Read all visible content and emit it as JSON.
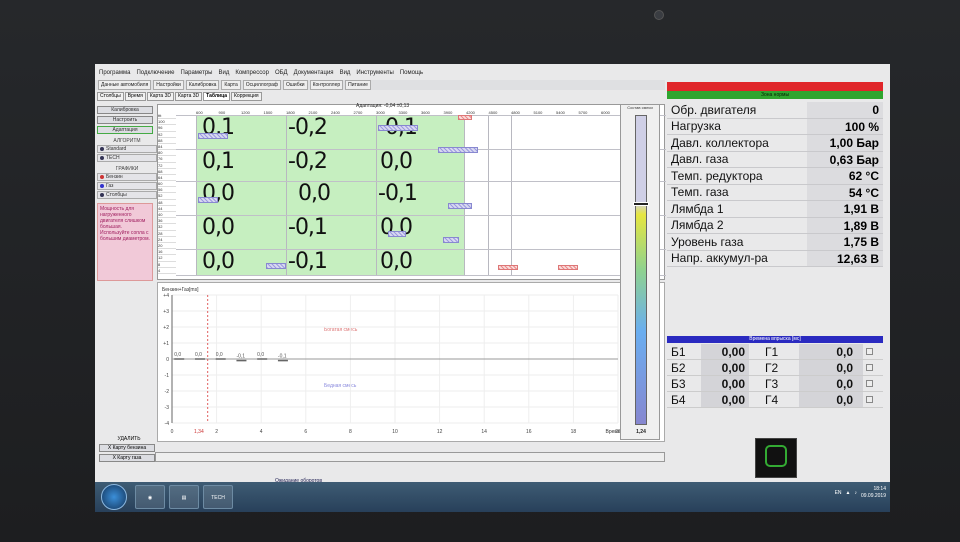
{
  "menu": [
    "Программа",
    "Подключение",
    "Параметры",
    "Вид",
    "Компрессор",
    "ОБД",
    "Документация",
    "Вид",
    "Инструменты",
    "Помощь"
  ],
  "toolbar": [
    "Данные автомобиля",
    "Настройки",
    "Калибровка",
    "Карта",
    "Осциллограф",
    "Ошибки",
    "Контроллер",
    "Питание"
  ],
  "tabs": [
    "Столбцы",
    "Время",
    "Карта 3D",
    "Карта 3D",
    "Таблица",
    "Коррекция"
  ],
  "active_tab_index": 4,
  "left": {
    "calibration": "Калибровка",
    "setup": "Настроить",
    "adaptation": "Адаптация",
    "algorithm_head": "АЛГОРИТМ",
    "algo_options": [
      "Standard",
      "TECH"
    ],
    "graphs_head": "ГРАФИКИ",
    "graph_options": [
      "Бензин",
      "Газ",
      "Столбцы"
    ],
    "note": "Мощность для нагруженного двигателя слишком большая. Используйте сопла с большим диаметром."
  },
  "grid": {
    "adapt_label": "Адаптация: -0,04   ±0,13",
    "col_headers": [
      "600",
      "900",
      "1200",
      "1500",
      "1800",
      "2100",
      "2400",
      "2700",
      "3000",
      "3300",
      "3600",
      "3900",
      "4200",
      "4500",
      "4800",
      "5100",
      "5400",
      "5700",
      "6000",
      "6300"
    ],
    "row_headers": [
      "ttt",
      "100",
      "96",
      "92",
      "88",
      "84",
      "80",
      "76",
      "72",
      "68",
      "64",
      "60",
      "56",
      "52",
      "48",
      "44",
      "40",
      "36",
      "32",
      "28",
      "24",
      "20",
      "16",
      "12",
      "8",
      "4"
    ],
    "cells": [
      [
        "0,1",
        "-0,2",
        "-0,1"
      ],
      [
        "0,1",
        "-0,2",
        "0,0"
      ],
      [
        "0,0",
        "0,0",
        "-0,1"
      ],
      [
        "0,0",
        "-0,1",
        "0,0"
      ],
      [
        "0,0",
        "-0,1",
        "0,0"
      ]
    ]
  },
  "chart_data": {
    "type": "line",
    "title": "Бензин+Газ[ms]",
    "xlabel": "Время[ms]",
    "ylabel": "",
    "x_ticks": [
      "0",
      "2",
      "4",
      "6",
      "8",
      "10",
      "12",
      "14",
      "16",
      "18",
      "20"
    ],
    "y_ticks": [
      "+4",
      "+3",
      "+2",
      "+1",
      "0",
      "-1",
      "-2",
      "-3",
      "-4"
    ],
    "marker_label": "1,34",
    "series": [
      {
        "values": [
          0,
          0,
          0,
          -0.1,
          0,
          -0.1
        ]
      }
    ],
    "annotations": [
      "Богатая смесь",
      "Бедная смесь"
    ],
    "value_labels": [
      "0,0",
      "0,0",
      "0,0",
      "-0,1",
      "0,0",
      "-0,1"
    ],
    "xlim": [
      0,
      20
    ],
    "ylim": [
      -4,
      4
    ]
  },
  "bottom_left": {
    "delete": "УДАЛИТЬ",
    "petrol_map": "X Карту бензина",
    "gas_map": "X Карту газа"
  },
  "status": "Ожидание оборотов",
  "gauge": {
    "title": "Состав смеси",
    "value": "1,24",
    "fill": 0.72
  },
  "right": {
    "zone_label": "Зона нормы",
    "params": [
      {
        "label": "Обр. двигателя",
        "value": "0"
      },
      {
        "label": "Нагрузка",
        "value": "100 %"
      },
      {
        "label": "Давл. коллектора",
        "value": "1,00 Бар"
      },
      {
        "label": "Давл. газа",
        "value": "0,63 Бар"
      },
      {
        "label": "Темп. редуктора",
        "value": "62 °C"
      },
      {
        "label": "Темп. газа",
        "value": "54 °C"
      },
      {
        "label": "Лямбда 1",
        "value": "1,91 В"
      },
      {
        "label": "Лямбда 2",
        "value": "1,89 В"
      },
      {
        "label": "Уровень газа",
        "value": "1,75 В"
      },
      {
        "label": "Напр. аккумул-ра",
        "value": "12,63 В"
      }
    ],
    "injection_title": "Времена впрыска [мс]",
    "injection": [
      {
        "b": "Б1",
        "bv": "0,00",
        "g": "Г1",
        "gv": "0,0"
      },
      {
        "b": "Б2",
        "bv": "0,00",
        "g": "Г2",
        "gv": "0,0"
      },
      {
        "b": "Б3",
        "bv": "0,00",
        "g": "Г3",
        "gv": "0,0"
      },
      {
        "b": "Б4",
        "bv": "0,00",
        "g": "Г4",
        "gv": "0,0"
      }
    ]
  },
  "taskbar": {
    "lang": "EN",
    "time": "18:14",
    "date": "09.09.2019",
    "app_label": "TECH"
  }
}
